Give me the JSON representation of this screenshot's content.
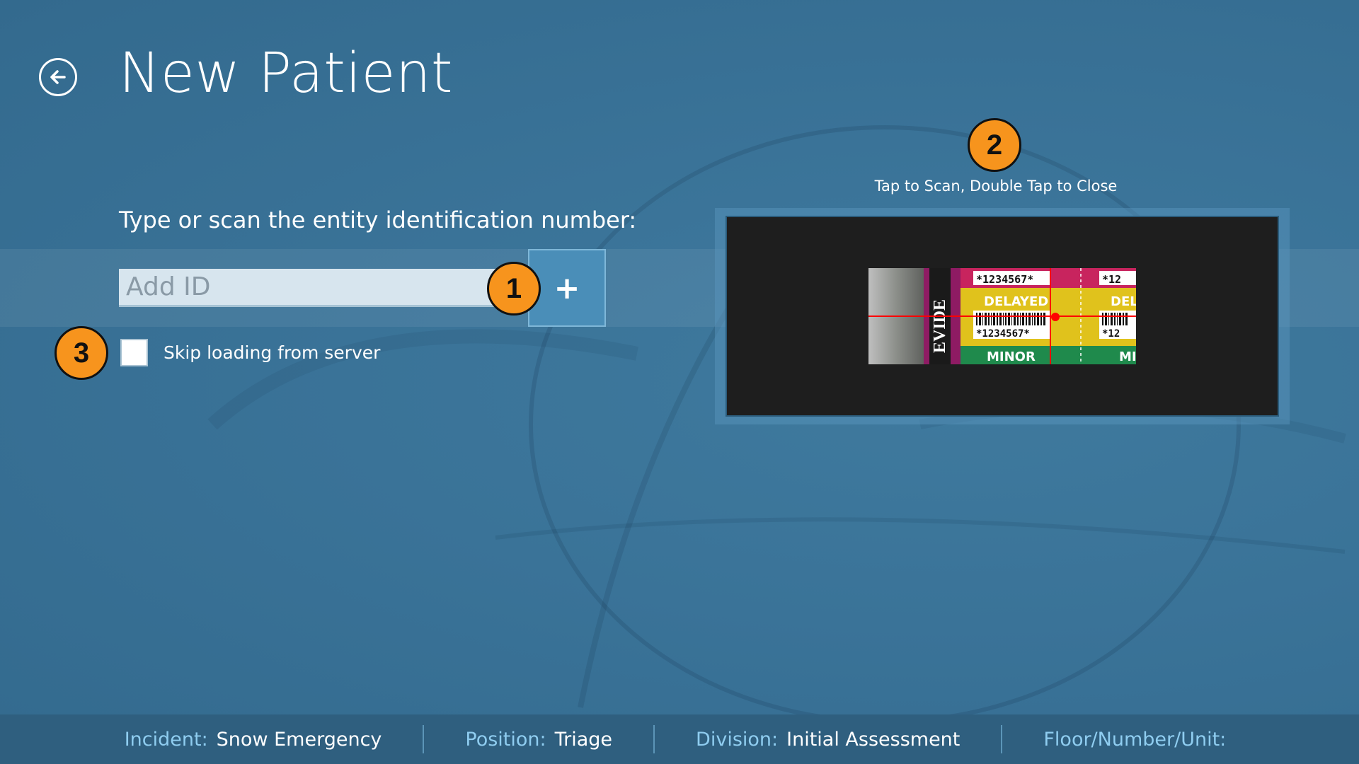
{
  "header": {
    "title": "New Patient",
    "back_icon": "back-arrow-icon"
  },
  "form": {
    "prompt": "Type or scan the entity identification number:",
    "id_placeholder": "Add ID",
    "id_value": "",
    "add_button_label": "+",
    "skip_label": "Skip loading from server",
    "skip_checked": false
  },
  "scanner": {
    "hint": "Tap to Scan, Double Tap to Close",
    "tag_text": {
      "number": "*1234567*",
      "number_short": "*12",
      "delayed": "DELAYED",
      "delayed_short": "DEL",
      "minor": "MINOR",
      "minor_short": "MI",
      "evidence": "EVIDE"
    }
  },
  "callouts": [
    "1",
    "2",
    "3"
  ],
  "status_bar": {
    "items": [
      {
        "label": "Incident:",
        "value": "Snow Emergency"
      },
      {
        "label": "Position:",
        "value": "Triage"
      },
      {
        "label": "Division:",
        "value": "Initial Assessment"
      },
      {
        "label": "Floor/Number/Unit:",
        "value": ""
      }
    ]
  },
  "colors": {
    "background": "#3a7398",
    "callout": "#f7941d",
    "status_bar": "#2f5f7f",
    "status_label": "#8fcdf0",
    "add_button": "#4a8eb8",
    "scanner_bg": "#1e1e1e",
    "scan_line": "#ff0000"
  }
}
